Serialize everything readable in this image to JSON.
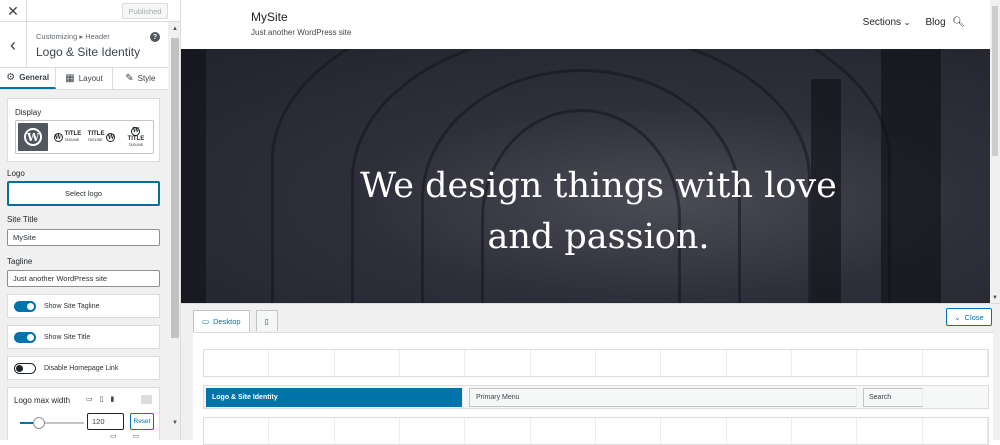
{
  "sidebar": {
    "close_glyph": "✕",
    "published_label": "Published",
    "back_glyph": "‹",
    "breadcrumb": "Customizing ▸ Header",
    "title": "Logo & Site Identity",
    "help_glyph": "?",
    "tabs": [
      {
        "label": "General",
        "icon": "gear-icon",
        "active": true
      },
      {
        "label": "Layout",
        "icon": "layout-icon",
        "active": false
      },
      {
        "label": "Style",
        "icon": "brush-icon",
        "active": false
      }
    ],
    "display": {
      "label": "Display",
      "options": [
        "logo-only",
        "logo-title-tagline",
        "title-tagline-logo",
        "logo-above-title"
      ],
      "option_text": "TITLE",
      "option_subtext": "TAGLINE",
      "selected": "logo-only"
    },
    "logo": {
      "label": "Logo",
      "button": "Select logo"
    },
    "site_title": {
      "label": "Site Title",
      "value": "MySite"
    },
    "tagline": {
      "label": "Tagline",
      "value": "Just another WordPress site"
    },
    "toggles": [
      {
        "label": "Show Site Tagline",
        "on": true
      },
      {
        "label": "Show Site Title",
        "on": true
      },
      {
        "label": "Disable Homepage Link",
        "on": false
      }
    ],
    "max_width": {
      "label": "Logo max width",
      "value": "120",
      "reset": "Reset",
      "slider_fraction": 0.3
    }
  },
  "preview": {
    "site_name": "MySite",
    "site_description": "Just another WordPress site",
    "nav": {
      "sections": "Sections",
      "blog": "Blog"
    },
    "hero_line1": "We design things with love",
    "hero_line2": "and passion."
  },
  "builder": {
    "desktop_tab": "Desktop",
    "close_label": "Close",
    "items": {
      "logo": "Logo & Site Identity",
      "menu": "Primary Menu",
      "search": "Search"
    }
  },
  "colors": {
    "accent": "#0073aa",
    "hero_bg": "#2e2f3a"
  }
}
